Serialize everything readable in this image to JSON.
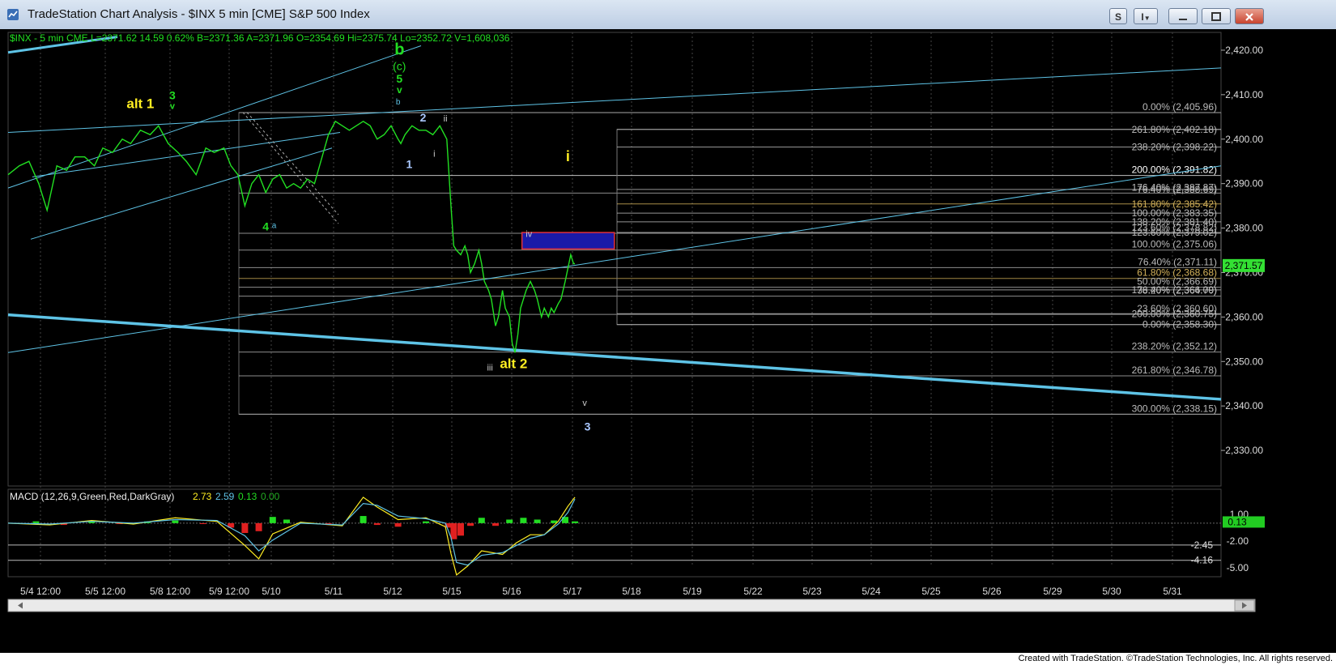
{
  "window": {
    "title": "TradeStation Chart Analysis - $INX 5 min [CME] S&P 500 Index",
    "btn_s": "S",
    "btn_i": "I"
  },
  "footer": {
    "credit": "Created with TradeStation. ©TradeStation Technologies, Inc. All rights reserved."
  },
  "chart_data": {
    "type": "line",
    "symbol_header": "$INX - 5 min  CME  L=2371.62  14.59  0.62%  B=2371.36  A=2371.96  O=2354.69  Hi=2375.74  Lo=2352.72  V=1,608,036",
    "ylim": [
      2322,
      2424
    ],
    "y_ticks": [
      "2,330.00",
      "2,340.00",
      "2,350.00",
      "2,360.00",
      "2,370.00",
      "2,380.00",
      "2,390.00",
      "2,400.00",
      "2,410.00",
      "2,420.00"
    ],
    "y_tick_values": [
      2330,
      2340,
      2350,
      2360,
      2370,
      2380,
      2390,
      2400,
      2410,
      2420
    ],
    "last_price_label": "2,371.57",
    "last_price": 2371.57,
    "x_ticks": [
      "5/4 12:00",
      "5/5 12:00",
      "5/8 12:00",
      "5/9 12:00",
      "5/10",
      "5/11",
      "5/12",
      "5/15",
      "5/16",
      "5/17",
      "5/18",
      "5/19",
      "5/22",
      "5/23",
      "5/24",
      "5/25",
      "5/26",
      "5/29",
      "5/30",
      "5/31"
    ],
    "series": [
      {
        "points": [
          [
            0,
            2392
          ],
          [
            8,
            2394
          ],
          [
            15,
            2395
          ],
          [
            22,
            2390
          ],
          [
            28,
            2384
          ],
          [
            35,
            2394
          ],
          [
            42,
            2393
          ],
          [
            48,
            2396
          ],
          [
            55,
            2396
          ],
          [
            62,
            2394
          ],
          [
            68,
            2398
          ],
          [
            75,
            2397
          ],
          [
            82,
            2400
          ],
          [
            88,
            2399
          ],
          [
            95,
            2402
          ],
          [
            102,
            2401
          ],
          [
            108,
            2403
          ],
          [
            115,
            2399
          ],
          [
            122,
            2397
          ],
          [
            128,
            2395
          ],
          [
            135,
            2392
          ],
          [
            142,
            2398
          ],
          [
            148,
            2397
          ],
          [
            155,
            2398
          ],
          [
            160,
            2394
          ],
          [
            165,
            2392
          ],
          [
            170,
            2385
          ],
          [
            175,
            2390
          ],
          [
            180,
            2392
          ],
          [
            185,
            2388
          ],
          [
            190,
            2391
          ],
          [
            195,
            2392
          ],
          [
            200,
            2389
          ],
          [
            205,
            2390
          ],
          [
            210,
            2389
          ],
          [
            215,
            2391
          ],
          [
            220,
            2390
          ],
          [
            230,
            2401
          ],
          [
            235,
            2404
          ],
          [
            240,
            2403
          ],
          [
            245,
            2402
          ],
          [
            250,
            2403
          ],
          [
            255,
            2404
          ],
          [
            260,
            2403
          ],
          [
            265,
            2400
          ],
          [
            270,
            2401
          ],
          [
            275,
            2403
          ],
          [
            280,
            2400
          ],
          [
            282,
            2399
          ],
          [
            285,
            2401
          ],
          [
            290,
            2403
          ],
          [
            295,
            2402
          ],
          [
            300,
            2402
          ],
          [
            305,
            2401
          ],
          [
            310,
            2403
          ],
          [
            315,
            2400
          ],
          [
            318,
            2385
          ],
          [
            320,
            2376
          ],
          [
            322,
            2375
          ],
          [
            325,
            2374
          ],
          [
            328,
            2376
          ],
          [
            330,
            2374
          ],
          [
            332,
            2370
          ],
          [
            335,
            2372
          ],
          [
            338,
            2375
          ],
          [
            340,
            2372
          ],
          [
            342,
            2368
          ],
          [
            345,
            2366
          ],
          [
            347,
            2364
          ],
          [
            350,
            2358
          ],
          [
            352,
            2360
          ],
          [
            355,
            2366
          ],
          [
            357,
            2362
          ],
          [
            360,
            2360
          ],
          [
            362,
            2354
          ],
          [
            364,
            2352
          ],
          [
            366,
            2356
          ],
          [
            368,
            2362
          ],
          [
            370,
            2364
          ],
          [
            372,
            2366
          ],
          [
            375,
            2368
          ],
          [
            378,
            2366
          ],
          [
            380,
            2364
          ],
          [
            383,
            2360
          ],
          [
            385,
            2362
          ],
          [
            388,
            2360
          ],
          [
            390,
            2362
          ],
          [
            392,
            2361
          ],
          [
            395,
            2363
          ],
          [
            397,
            2364
          ],
          [
            400,
            2368
          ],
          [
            402,
            2371
          ],
          [
            404,
            2374
          ],
          [
            406,
            2372
          ],
          [
            407,
            2372
          ]
        ]
      }
    ],
    "wave_labels": [
      {
        "text": "b",
        "x": 281,
        "y": 2419,
        "color": "#22dd22",
        "size": 20,
        "weight": "bold"
      },
      {
        "text": "(c)",
        "x": 281,
        "y": 2415.5,
        "color": "#22dd22",
        "size": 14,
        "weight": "normal"
      },
      {
        "text": "5",
        "x": 281,
        "y": 2412.7,
        "color": "#22dd22",
        "size": 14,
        "weight": "bold"
      },
      {
        "text": "v",
        "x": 281,
        "y": 2410.3,
        "color": "#22dd22",
        "size": 12,
        "weight": "bold"
      },
      {
        "text": "b",
        "x": 280,
        "y": 2407.8,
        "color": "#5ec3e6",
        "size": 10,
        "weight": "normal"
      },
      {
        "text": "alt 1",
        "x": 95,
        "y": 2407,
        "color": "#ffee22",
        "size": 17,
        "weight": "bold"
      },
      {
        "text": "3",
        "x": 118,
        "y": 2409,
        "color": "#22dd22",
        "size": 14,
        "weight": "bold"
      },
      {
        "text": "v",
        "x": 118,
        "y": 2406.8,
        "color": "#22dd22",
        "size": 11,
        "weight": "bold"
      },
      {
        "text": "2",
        "x": 298,
        "y": 2404,
        "color": "#aac8ff",
        "size": 14,
        "weight": "bold"
      },
      {
        "text": "ii",
        "x": 314,
        "y": 2404,
        "color": "#cccccc",
        "size": 11,
        "weight": "normal"
      },
      {
        "text": "i",
        "x": 306,
        "y": 2396,
        "color": "#cccccc",
        "size": 11,
        "weight": "normal"
      },
      {
        "text": "1",
        "x": 288,
        "y": 2393.5,
        "color": "#aac8ff",
        "size": 14,
        "weight": "bold"
      },
      {
        "text": "4",
        "x": 185,
        "y": 2379.5,
        "color": "#22dd22",
        "size": 14,
        "weight": "bold"
      },
      {
        "text": "a",
        "x": 191,
        "y": 2380,
        "color": "#5ec3e6",
        "size": 10,
        "weight": "normal"
      },
      {
        "text": "i",
        "x": 402,
        "y": 2395,
        "color": "#ffee22",
        "size": 18,
        "weight": "bold"
      },
      {
        "text": "iv",
        "x": 374,
        "y": 2378,
        "color": "#cccccc",
        "size": 11,
        "weight": "normal"
      },
      {
        "text": "iii",
        "x": 346,
        "y": 2348,
        "color": "#cccccc",
        "size": 11,
        "weight": "normal"
      },
      {
        "text": "alt 2",
        "x": 363,
        "y": 2348.5,
        "color": "#ffee22",
        "size": 17,
        "weight": "bold"
      },
      {
        "text": "v",
        "x": 414,
        "y": 2340,
        "color": "#cccccc",
        "size": 11,
        "weight": "normal"
      },
      {
        "text": "3",
        "x": 416,
        "y": 2334.5,
        "color": "#aac8ff",
        "size": 14,
        "weight": "bold"
      }
    ],
    "fib_left_block": [
      {
        "label": "0.00% (2,405.96)",
        "y": 2405.96,
        "color": "#bbbbbb"
      },
      {
        "label": "200.00% (2,391.82)",
        "y": 2391.82,
        "color": "#ffffff"
      },
      {
        "label": "176.40% (2,387.87)",
        "y": 2387.87,
        "color": "#bbbbbb"
      },
      {
        "label": "100.00% (2,375.06)",
        "y": 2375.06,
        "color": "#bbbbbb"
      },
      {
        "label": "123.60% (2,378.82)",
        "y": 2378.82,
        "color": "#bbbbbb"
      },
      {
        "label": "76.40% (2,371.11)",
        "y": 2371.11,
        "color": "#bbbbbb"
      },
      {
        "label": "61.80% (2,368.68)",
        "y": 2368.68,
        "color": "#d4b25a"
      },
      {
        "label": "50.00% (2,366.69)",
        "y": 2366.69,
        "color": "#bbbbbb"
      },
      {
        "label": "38.20% (2,364.70)",
        "y": 2364.7,
        "color": "#bbbbbb"
      },
      {
        "label": "23.60% (2,360.60)",
        "y": 2360.6,
        "color": "#bbbbbb"
      },
      {
        "label": "238.20% (2,352.12)",
        "y": 2352.12,
        "color": "#bbbbbb"
      },
      {
        "label": "261.80% (2,346.78)",
        "y": 2346.78,
        "color": "#bbbbbb"
      },
      {
        "label": "300.00% (2,338.15)",
        "y": 2338.15,
        "color": "#bbbbbb"
      }
    ],
    "fib_right_block": [
      {
        "label": "261.80% (2,402.18)",
        "y": 2402.18,
        "color": "#bbbbbb"
      },
      {
        "label": "238.20% (2,398.22)",
        "y": 2398.22,
        "color": "#bbbbbb"
      },
      {
        "label": "76.40% (2,388.69)",
        "y": 2388.69,
        "color": "#bbbbbb"
      },
      {
        "label": "161.80% (2,385.42)",
        "y": 2385.42,
        "color": "#d4b25a"
      },
      {
        "label": "100.00% (2,383.35)",
        "y": 2383.35,
        "color": "#bbbbbb"
      },
      {
        "label": "138.20% (2,381.40)",
        "y": 2381.4,
        "color": "#bbbbbb"
      },
      {
        "label": "123.60% (2,379.02)",
        "y": 2379.02,
        "color": "#bbbbbb"
      },
      {
        "label": "176.40% (2,366.09)",
        "y": 2366.09,
        "color": "#bbbbbb"
      },
      {
        "label": "200.00% (2,360.75)",
        "y": 2360.75,
        "color": "#bbbbbb"
      },
      {
        "label": "0.00% (2,358.30)",
        "y": 2358.3,
        "color": "#bbbbbb"
      }
    ],
    "target_box": {
      "y_top": 2379,
      "y_bottom": 2375.3,
      "x_start": 369,
      "x_end": 420
    },
    "macd": {
      "header": "MACD (12,26,9,Green,Red,DarkGray)",
      "values": [
        "2.73",
        "2.59",
        "0.13",
        "0.00"
      ],
      "value_colors": [
        "#ffee22",
        "#5ec3e6",
        "#22dd22",
        "#22aa22"
      ],
      "ylim": [
        -6,
        3.8
      ],
      "ticks": [
        "1.00",
        "-2.00",
        "-5.00"
      ],
      "tick_values": [
        1,
        -2,
        -5
      ],
      "levels": [
        {
          "label": "-2.45",
          "v": -2.45
        },
        {
          "label": "-4.16",
          "v": -4.16
        }
      ],
      "last_label": "0.13",
      "last_value": 0.13,
      "macd_line": [
        [
          0,
          0
        ],
        [
          30,
          -0.2
        ],
        [
          60,
          0.3
        ],
        [
          90,
          -0.1
        ],
        [
          120,
          0.6
        ],
        [
          150,
          0.2
        ],
        [
          170,
          -2.5
        ],
        [
          180,
          -4.0
        ],
        [
          190,
          -1.2
        ],
        [
          210,
          0.1
        ],
        [
          240,
          -0.3
        ],
        [
          255,
          2.9
        ],
        [
          265,
          1.8
        ],
        [
          280,
          0.4
        ],
        [
          300,
          0.6
        ],
        [
          314,
          -0.4
        ],
        [
          318,
          -3.4
        ],
        [
          322,
          -5.8
        ],
        [
          330,
          -4.8
        ],
        [
          340,
          -3.1
        ],
        [
          355,
          -3.5
        ],
        [
          365,
          -2.2
        ],
        [
          375,
          -1.3
        ],
        [
          385,
          -1.3
        ],
        [
          395,
          0.2
        ],
        [
          402,
          1.9
        ],
        [
          407,
          2.9
        ]
      ],
      "signal_line": [
        [
          0,
          0
        ],
        [
          30,
          -0.1
        ],
        [
          60,
          0.2
        ],
        [
          90,
          0
        ],
        [
          120,
          0.4
        ],
        [
          150,
          0.3
        ],
        [
          170,
          -1.4
        ],
        [
          180,
          -3.1
        ],
        [
          190,
          -1.9
        ],
        [
          210,
          0
        ],
        [
          240,
          -0.2
        ],
        [
          255,
          2.2
        ],
        [
          265,
          2.0
        ],
        [
          280,
          0.8
        ],
        [
          300,
          0.5
        ],
        [
          314,
          0
        ],
        [
          318,
          -1.6
        ],
        [
          322,
          -4.4
        ],
        [
          330,
          -4.7
        ],
        [
          340,
          -3.6
        ],
        [
          355,
          -3.3
        ],
        [
          365,
          -2.5
        ],
        [
          375,
          -1.7
        ],
        [
          385,
          -1.3
        ],
        [
          395,
          -0.1
        ],
        [
          402,
          1.2
        ],
        [
          407,
          2.7
        ]
      ],
      "histogram": [
        [
          20,
          0.2
        ],
        [
          40,
          -0.2
        ],
        [
          60,
          0.3
        ],
        [
          80,
          -0.1
        ],
        [
          100,
          0.2
        ],
        [
          120,
          0.3
        ],
        [
          140,
          -0.1
        ],
        [
          160,
          -0.5
        ],
        [
          170,
          -1.1
        ],
        [
          180,
          -0.9
        ],
        [
          190,
          0.7
        ],
        [
          200,
          0.4
        ],
        [
          230,
          -0.2
        ],
        [
          255,
          0.8
        ],
        [
          265,
          -0.2
        ],
        [
          280,
          -0.4
        ],
        [
          300,
          0.2
        ],
        [
          316,
          -0.5
        ],
        [
          320,
          -1.8
        ],
        [
          325,
          -1.4
        ],
        [
          332,
          -0.3
        ],
        [
          340,
          0.6
        ],
        [
          350,
          -0.3
        ],
        [
          360,
          0.4
        ],
        [
          370,
          0.6
        ],
        [
          380,
          0.4
        ],
        [
          392,
          0.3
        ],
        [
          400,
          0.7
        ],
        [
          407,
          0.2
        ]
      ]
    }
  }
}
